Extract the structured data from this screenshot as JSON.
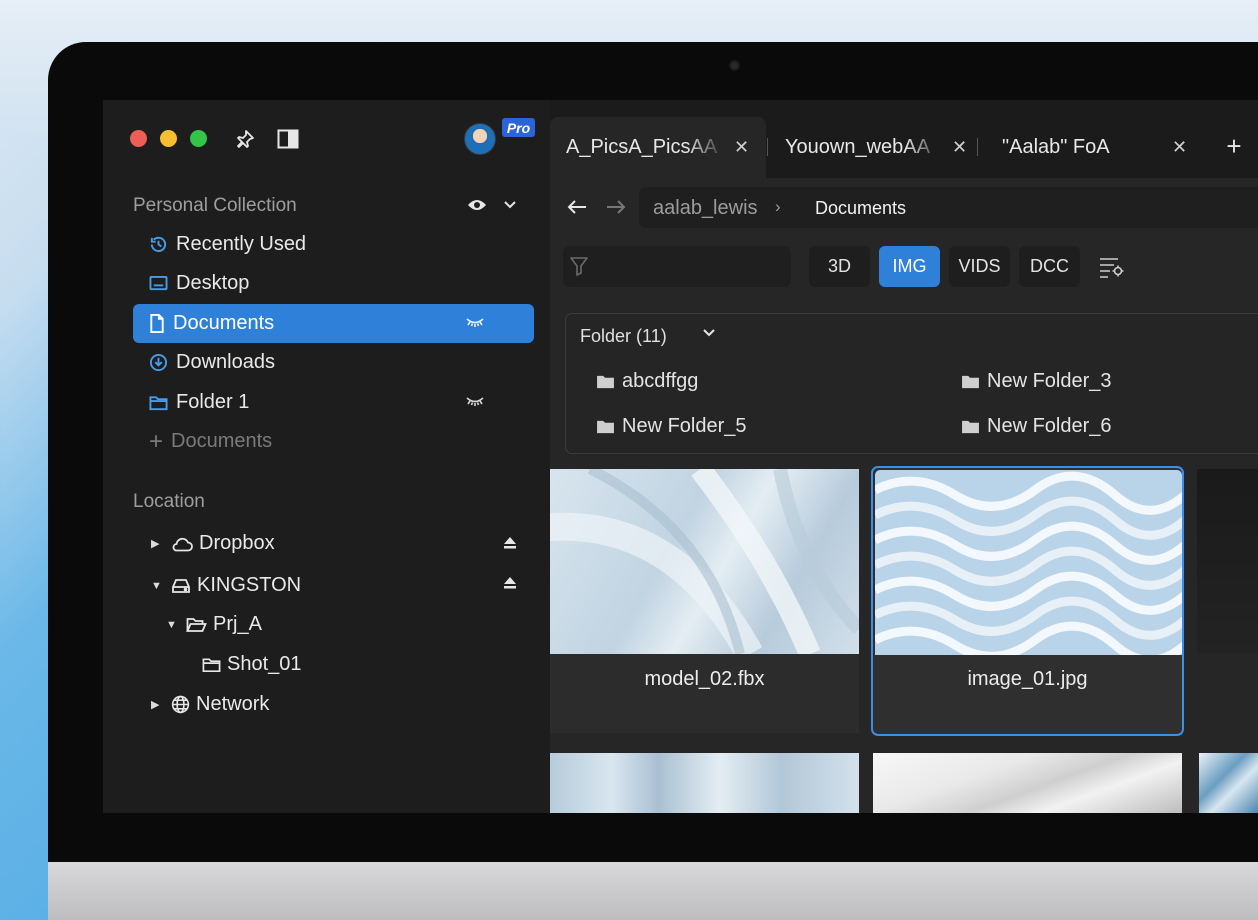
{
  "app": {
    "badge": "Pro"
  },
  "sidebar": {
    "personal_title": "Personal Collection",
    "items": [
      {
        "label": "Recently Used",
        "icon": "clock-history-icon"
      },
      {
        "label": "Desktop",
        "icon": "desktop-icon"
      },
      {
        "label": "Documents",
        "icon": "document-icon",
        "active": true
      },
      {
        "label": "Downloads",
        "icon": "download-icon"
      },
      {
        "label": "Folder 1",
        "icon": "folder-icon"
      }
    ],
    "add_label": "Documents",
    "location_title": "Location",
    "locations": [
      {
        "label": "Dropbox",
        "icon": "cloud-icon"
      },
      {
        "label": "KINGSTON",
        "icon": "drive-icon"
      },
      {
        "label": "Prj_A",
        "icon": "folder-open-icon"
      },
      {
        "label": "Shot_01",
        "icon": "folder-icon"
      },
      {
        "label": "Network",
        "icon": "globe-icon"
      }
    ]
  },
  "tabs": [
    {
      "label": "A_PicsA_PicsAA"
    },
    {
      "label": "Youown_webAA"
    },
    {
      "label": "\"Aalab\" FoA"
    }
  ],
  "breadcrumb": {
    "root": "aalab_lewis",
    "current": "Documents"
  },
  "filters": {
    "placeholder": "",
    "chips": [
      "3D",
      "IMG",
      "VIDS",
      "DCC"
    ],
    "active": "IMG"
  },
  "folders": {
    "header": "Folder (11)",
    "items": [
      "abcdffgg",
      "New Folder_3",
      "New Folder_5",
      "New Folder_6"
    ]
  },
  "files": [
    {
      "name": "model_02.fbx"
    },
    {
      "name": "image_01.jpg",
      "selected": true
    }
  ],
  "colors": {
    "accent": "#2f80d8",
    "sidebar_bg": "#1d1d1d",
    "content_bg": "#262626"
  }
}
